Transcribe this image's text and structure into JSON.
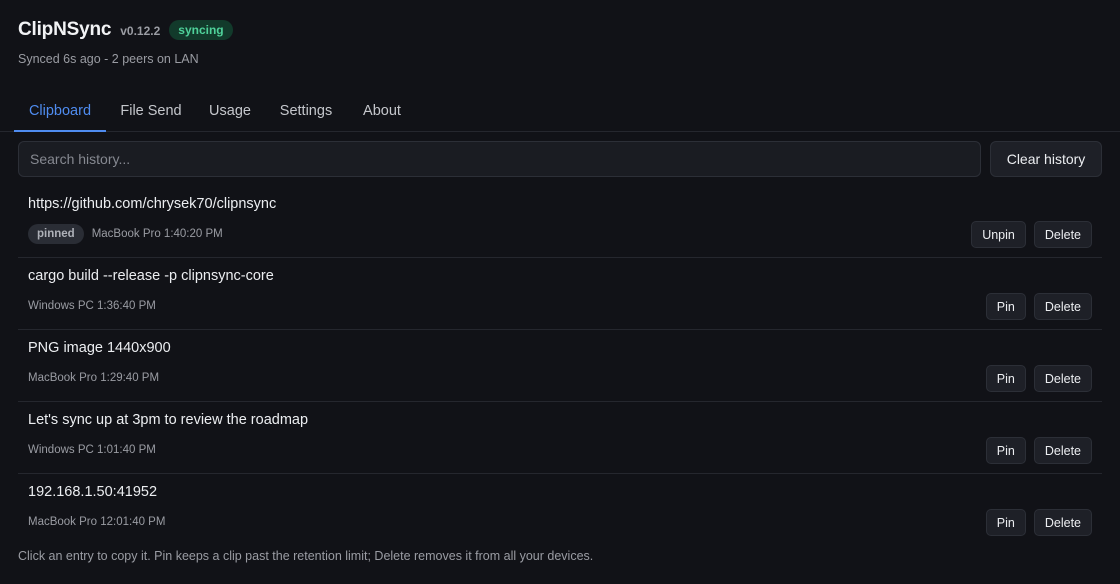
{
  "app": {
    "name": "ClipNSync",
    "version": "v0.12.2",
    "status_badge": "syncing",
    "status_line": "Synced 6s ago - 2 peers on LAN"
  },
  "tabs": [
    {
      "label": "Clipboard",
      "active": true
    },
    {
      "label": "File Send",
      "active": false
    },
    {
      "label": "Usage",
      "active": false
    },
    {
      "label": "Settings",
      "active": false
    },
    {
      "label": "About",
      "active": false
    }
  ],
  "search": {
    "placeholder": "Search history...",
    "value": ""
  },
  "clear_label": "Clear history",
  "items": [
    {
      "text": "https://github.com/chrysek70/clipnsync",
      "pinned": true,
      "pinned_label": "pinned",
      "meta": "MacBook Pro 1:40:20 PM",
      "pin_label": "Unpin",
      "delete_label": "Delete"
    },
    {
      "text": "cargo build --release -p clipnsync-core",
      "pinned": false,
      "meta": "Windows PC 1:36:40 PM",
      "pin_label": "Pin",
      "delete_label": "Delete"
    },
    {
      "text": "PNG image 1440x900",
      "pinned": false,
      "meta": "MacBook Pro 1:29:40 PM",
      "pin_label": "Pin",
      "delete_label": "Delete"
    },
    {
      "text": "Let's sync up at 3pm to review the roadmap",
      "pinned": false,
      "meta": "Windows PC 1:01:40 PM",
      "pin_label": "Pin",
      "delete_label": "Delete"
    },
    {
      "text": "192.168.1.50:41952",
      "pinned": false,
      "meta": "MacBook Pro 12:01:40 PM",
      "pin_label": "Pin",
      "delete_label": "Delete"
    }
  ],
  "footer": "Click an entry to copy it. Pin keeps a clip past the retention limit; Delete removes it from all your devices.",
  "colors": {
    "background": "#111217",
    "accent": "#4f8cf0",
    "syncing_badge_bg": "#123a2b",
    "syncing_badge_text": "#4fd19a"
  }
}
